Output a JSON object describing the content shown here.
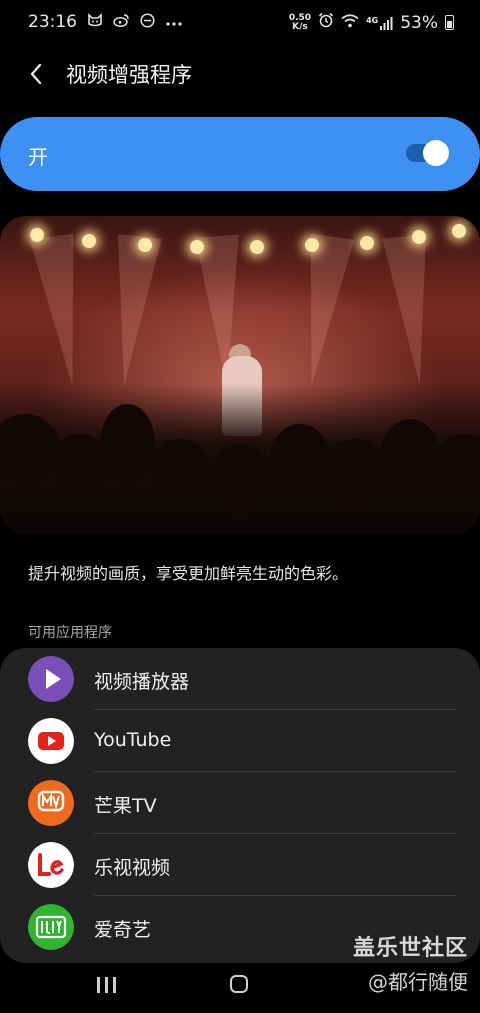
{
  "status_bar": {
    "time": "23:16",
    "left_icons": [
      "cat-icon",
      "weibo-icon",
      "do-not-disturb-icon",
      "more-icon"
    ],
    "speed_value": "0.50",
    "speed_unit": "K/s",
    "network": "4G",
    "battery": "53%",
    "battery_level": 0.53
  },
  "header": {
    "title": "视频增强程序"
  },
  "toggle": {
    "label": "开",
    "on": true,
    "accent_color": "#3e91f2"
  },
  "description": "提升视频的画质，享受更加鲜亮生动的色彩。",
  "section": {
    "label": "可用应用程序"
  },
  "apps": [
    {
      "name": "视频播放器",
      "icon": "video-player-icon",
      "color": "#7b4fb8"
    },
    {
      "name": "YouTube",
      "icon": "youtube-icon",
      "color": "#e62117"
    },
    {
      "name": "芒果TV",
      "icon": "mango-tv-icon",
      "color": "#f06a1e"
    },
    {
      "name": "乐视视频",
      "icon": "letv-icon",
      "color": "#e02020"
    },
    {
      "name": "爱奇艺",
      "icon": "iqiyi-icon",
      "color": "#2fb52f"
    }
  ],
  "watermark": {
    "line1": "盖乐世社区",
    "line2": "@都行随便"
  }
}
